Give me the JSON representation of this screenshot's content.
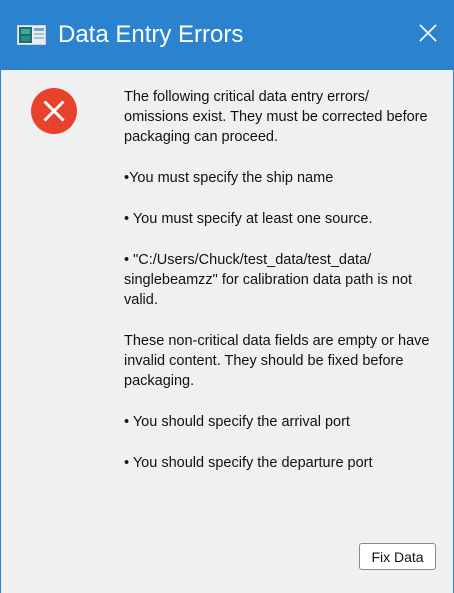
{
  "window": {
    "title": "Data Entry Errors",
    "icon": "app-window-icon",
    "close_icon": "close-icon"
  },
  "message": {
    "error_icon": "error-icon",
    "critical_intro": "The following critical data entry errors/ omissions exist. They must be corrected before packaging can proceed.",
    "critical_errors": [
      "•You must specify the ship name",
      "• You must specify at least one source.",
      "• \"C:/Users/Chuck/test_data/test_data/ singlebeamzz\" for calibration data path is not valid."
    ],
    "noncritical_intro": "These non-critical data fields are empty or have invalid content. They should be fixed before packaging.",
    "noncritical_errors": [
      "• You should specify the arrival port",
      "• You should specify the departure port"
    ]
  },
  "buttons": {
    "fix_data": "Fix Data"
  },
  "colors": {
    "titlebar": "#2b83cf",
    "background": "#f0f0f0",
    "error_red": "#e8412c"
  }
}
